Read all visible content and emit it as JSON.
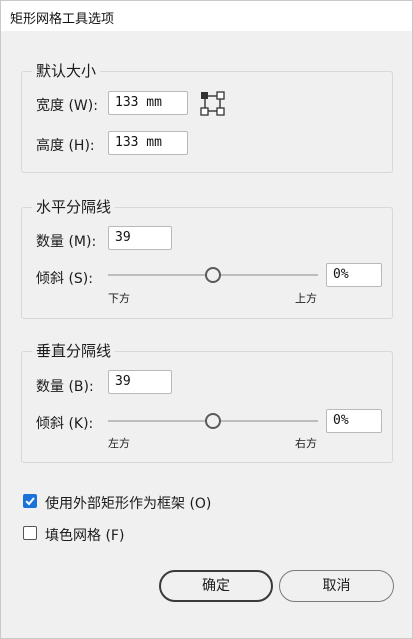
{
  "window": {
    "title": "矩形网格工具选项"
  },
  "default_size": {
    "title": "默认大小",
    "width_label": "宽度 (W):",
    "width_value": "133 mm",
    "height_label": "高度 (H):",
    "height_value": "133 mm",
    "origin_icon": "reference-point-icon"
  },
  "horizontal_dividers": {
    "title": "水平分隔线",
    "count_label": "数量 (M):",
    "count_value": "39",
    "skew_label": "倾斜 (S):",
    "skew_value": "0%",
    "skew_level": 0.5,
    "left_label": "下方",
    "right_label": "上方"
  },
  "vertical_dividers": {
    "title": "垂直分隔线",
    "count_label": "数量 (B):",
    "count_value": "39",
    "skew_label": "倾斜 (K):",
    "skew_value": "0%",
    "skew_level": 0.5,
    "left_label": "左方",
    "right_label": "右方"
  },
  "options": {
    "use_outer_rect_label": "使用外部矩形作为框架 (O)",
    "use_outer_rect_checked": true,
    "fill_grid_label": "填色网格 (F)",
    "fill_grid_checked": false
  },
  "buttons": {
    "ok_label": "确定",
    "cancel_label": "取消"
  },
  "colors": {
    "accent": "#1a73d8",
    "background": "#f0f0f0"
  }
}
